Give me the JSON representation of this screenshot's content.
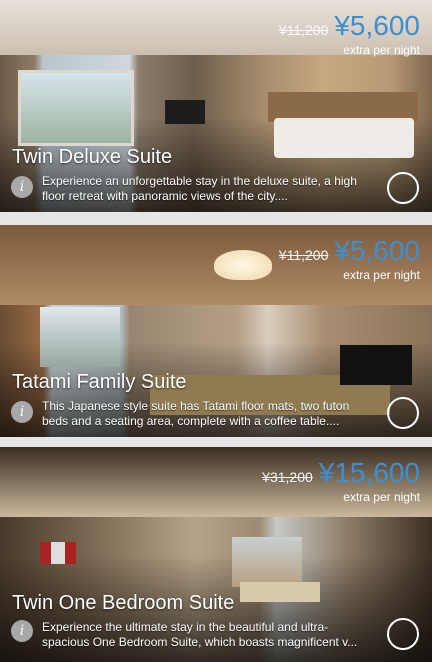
{
  "rooms": [
    {
      "title": "Twin Deluxe Suite",
      "original_price": "¥11,200",
      "price": "¥5,600",
      "price_note": "extra per night",
      "description": "Experience an unforgettable stay in the deluxe suite, a high floor retreat with panoramic views of the city....",
      "info_icon_glyph": "i"
    },
    {
      "title": "Tatami Family Suite",
      "original_price": "¥11,200",
      "price": "¥5,600",
      "price_note": "extra per night",
      "description": "This Japanese style suite has Tatami floor mats, two futon beds and a seating area, complete with a coffee table....",
      "info_icon_glyph": "i"
    },
    {
      "title": "Twin One Bedroom Suite",
      "original_price": "¥31,200",
      "price": "¥15,600",
      "price_note": "extra per night",
      "description": "Experience the ultimate stay in the beautiful and ultra-spacious One Bedroom Suite, which boasts magnificent v...",
      "info_icon_glyph": "i"
    }
  ],
  "colors": {
    "price_accent": "#3d8fd1",
    "text": "#ffffff",
    "divider": "#e6e6e6"
  },
  "icons": {
    "info": "info-icon",
    "select": "radio-select-icon"
  }
}
